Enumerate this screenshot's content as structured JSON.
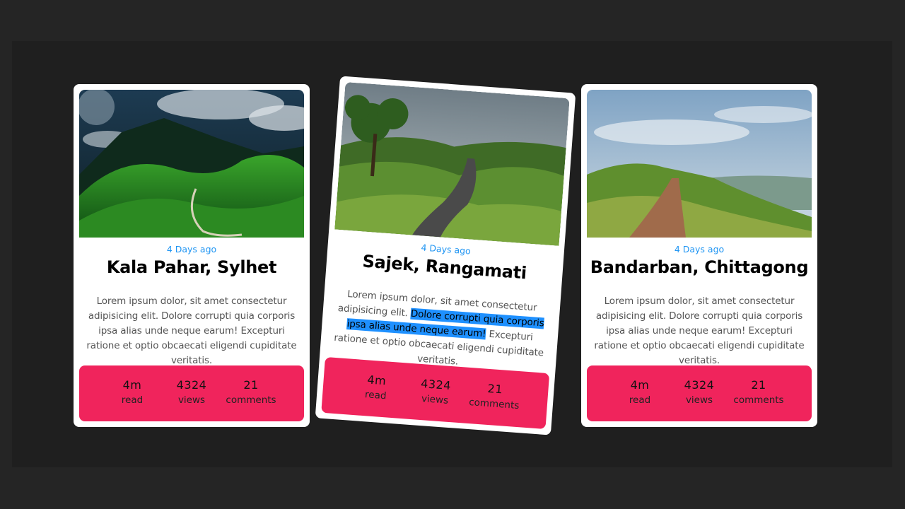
{
  "accent_color": "#f0245c",
  "date_color": "#2196f3",
  "cards": [
    {
      "date": "4 Days ago",
      "title": "Kala Pahar, Sylhet",
      "description": "Lorem ipsum dolor, sit amet consectetur adipisicing elit. Dolore corrupti quia corporis ipsa alias unde neque earum! Excepturi ratione et optio obcaecati eligendi cupiditate veritatis.",
      "image": "mountain-tea-garden-image",
      "stats": [
        {
          "value": "4m",
          "label": "read"
        },
        {
          "value": "4324",
          "label": "views"
        },
        {
          "value": "21",
          "label": "comments"
        }
      ]
    },
    {
      "date": "4 Days ago",
      "title": "Sajek, Rangamati",
      "description_before": "Lorem ipsum dolor, sit amet consectetur adipisicing elit. ",
      "description_selected": "Dolore corrupti quia corporis ipsa alias unde neque earum!",
      "description_after": " Excepturi ratione et optio obcaecati eligendi cupiditate veritatis.",
      "image": "winding-road-hills-image",
      "stats": [
        {
          "value": "4m",
          "label": "read"
        },
        {
          "value": "4324",
          "label": "views"
        },
        {
          "value": "21",
          "label": "comments"
        }
      ]
    },
    {
      "date": "4 Days ago",
      "title": "Bandarban, Chittagong",
      "description": "Lorem ipsum dolor, sit amet consectetur adipisicing elit. Dolore corrupti quia corporis ipsa alias unde neque earum! Excepturi ratione et optio obcaecati eligendi cupiditate veritatis.",
      "image": "hilltop-dirt-road-image",
      "stats": [
        {
          "value": "4m",
          "label": "read"
        },
        {
          "value": "4324",
          "label": "views"
        },
        {
          "value": "21",
          "label": "comments"
        }
      ]
    }
  ]
}
